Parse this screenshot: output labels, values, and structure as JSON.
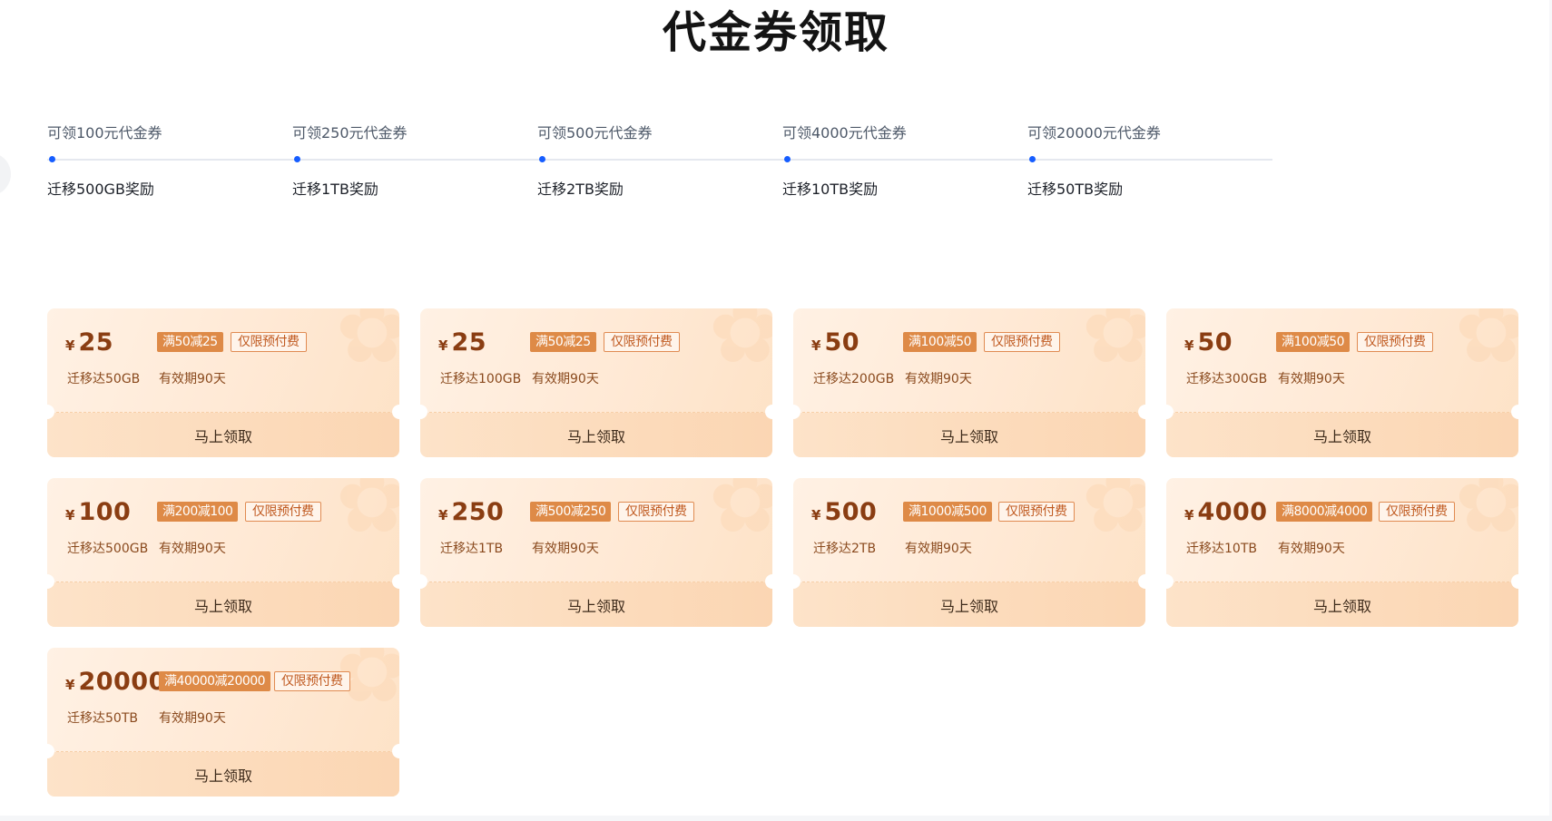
{
  "page": {
    "title": "代金券领取"
  },
  "steps": [
    {
      "label": "可领100元代金券",
      "reward": "迁移500GB奖励"
    },
    {
      "label": "可领250元代金券",
      "reward": "迁移1TB奖励"
    },
    {
      "label": "可领500元代金券",
      "reward": "迁移2TB奖励"
    },
    {
      "label": "可领4000元代金券",
      "reward": "迁移10TB奖励"
    },
    {
      "label": "可领20000元代金券",
      "reward": "迁移50TB奖励"
    }
  ],
  "coupon_common": {
    "currency": "¥",
    "prepaid_tag": "仅限预付费",
    "validity": "有效期90天",
    "claim_label": "马上领取"
  },
  "coupons": [
    {
      "amount": "25",
      "rule": "满50减25",
      "condition": "迁移达50GB"
    },
    {
      "amount": "25",
      "rule": "满50减25",
      "condition": "迁移达100GB"
    },
    {
      "amount": "50",
      "rule": "满100减50",
      "condition": "迁移达200GB"
    },
    {
      "amount": "50",
      "rule": "满100减50",
      "condition": "迁移达300GB"
    },
    {
      "amount": "100",
      "rule": "满200减100",
      "condition": "迁移达500GB"
    },
    {
      "amount": "250",
      "rule": "满500减250",
      "condition": "迁移达1TB"
    },
    {
      "amount": "500",
      "rule": "满1000减500",
      "condition": "迁移达2TB"
    },
    {
      "amount": "4000",
      "rule": "满8000减4000",
      "condition": "迁移达10TB"
    },
    {
      "amount": "20000",
      "rule": "满40000减20000",
      "condition": "迁移达50TB"
    }
  ],
  "colors": {
    "accent_blue": "#165dff",
    "coupon_text": "#8a3d12",
    "rule_tag_bg": "#de8a47",
    "card_bg": "#fff1e4"
  }
}
